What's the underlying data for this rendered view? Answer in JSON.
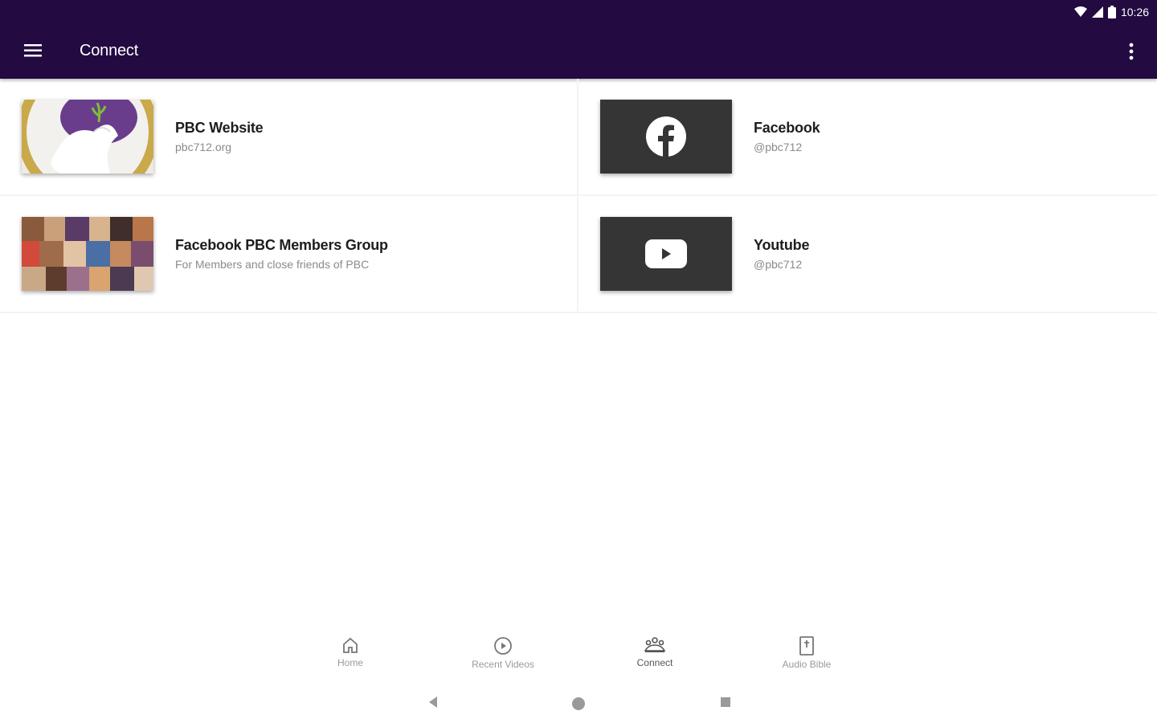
{
  "status_bar": {
    "time": "10:26"
  },
  "app_bar": {
    "title": "Connect"
  },
  "cards": [
    {
      "title": "PBC Website",
      "subtitle": "pbc712.org"
    },
    {
      "title": "Facebook",
      "subtitle": "@pbc712"
    },
    {
      "title": "Facebook PBC Members Group",
      "subtitle": "For Members and close friends of PBC"
    },
    {
      "title": "Youtube",
      "subtitle": "@pbc712"
    }
  ],
  "bottom_nav": {
    "items": [
      {
        "label": "Home",
        "icon": "home-icon"
      },
      {
        "label": "Recent Videos",
        "icon": "play-circle-icon"
      },
      {
        "label": "Connect",
        "icon": "people-icon"
      },
      {
        "label": "Audio Bible",
        "icon": "bible-icon"
      }
    ],
    "active": "Connect"
  },
  "colors": {
    "app_bar": "#230a41",
    "thumb_dark": "#353535"
  }
}
